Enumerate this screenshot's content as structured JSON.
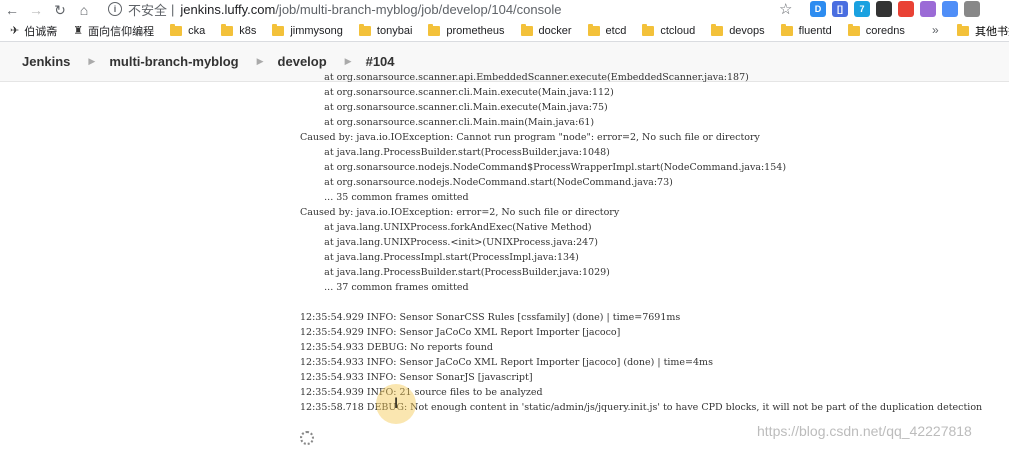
{
  "browser": {
    "insecure_label": "不安全",
    "url_domain": "jenkins.luffy.com",
    "url_path": "/job/multi-branch-myblog/job/develop/104/console",
    "extensions": [
      {
        "icon": "extension-d-icon",
        "text": "D",
        "color": "#2d8cf0"
      },
      {
        "icon": "extension-bracket-icon",
        "text": "[]",
        "color": "#4a6ee0"
      },
      {
        "icon": "extension-cloud-icon",
        "text": "7",
        "color": "#1aa1e0"
      },
      {
        "icon": "extension-qr-icon",
        "text": "",
        "color": "#333333"
      },
      {
        "icon": "extension-chrome-icon",
        "text": "",
        "color": "#e94235"
      },
      {
        "icon": "extension-palette-icon",
        "text": "",
        "color": "#9b6bd6"
      },
      {
        "icon": "extension-bird-icon",
        "text": "",
        "color": "#4f8ef7"
      },
      {
        "icon": "profile-avatar-icon",
        "text": "",
        "color": "#888888"
      }
    ]
  },
  "bookmarks": {
    "items": [
      {
        "label": "伯诚斋",
        "type": "logo"
      },
      {
        "label": "面向信仰编程",
        "type": "logo"
      },
      {
        "label": "cka",
        "type": "folder"
      },
      {
        "label": "k8s",
        "type": "folder"
      },
      {
        "label": "jimmysong",
        "type": "folder"
      },
      {
        "label": "tonybai",
        "type": "folder"
      },
      {
        "label": "prometheus",
        "type": "folder"
      },
      {
        "label": "docker",
        "type": "folder"
      },
      {
        "label": "etcd",
        "type": "folder"
      },
      {
        "label": "ctcloud",
        "type": "folder"
      },
      {
        "label": "devops",
        "type": "folder"
      },
      {
        "label": "fluentd",
        "type": "folder"
      },
      {
        "label": "coredns",
        "type": "folder"
      }
    ],
    "more": "»",
    "other_label": "其他书签"
  },
  "breadcrumb": {
    "items": [
      "Jenkins",
      "multi-branch-myblog",
      "develop",
      "#104"
    ]
  },
  "console": {
    "lines": [
      "        at org.sonarsource.scanner.api.EmbeddedScanner.execute(EmbeddedScanner.java:187)",
      "        at org.sonarsource.scanner.cli.Main.execute(Main.java:112)",
      "        at org.sonarsource.scanner.cli.Main.execute(Main.java:75)",
      "        at org.sonarsource.scanner.cli.Main.main(Main.java:61)",
      "Caused by: java.io.IOException: Cannot run program \"node\": error=2, No such file or directory",
      "        at java.lang.ProcessBuilder.start(ProcessBuilder.java:1048)",
      "        at org.sonarsource.nodejs.NodeCommand$ProcessWrapperImpl.start(NodeCommand.java:154)",
      "        at org.sonarsource.nodejs.NodeCommand.start(NodeCommand.java:73)",
      "        ... 35 common frames omitted",
      "Caused by: java.io.IOException: error=2, No such file or directory",
      "        at java.lang.UNIXProcess.forkAndExec(Native Method)",
      "        at java.lang.UNIXProcess.<init>(UNIXProcess.java:247)",
      "        at java.lang.ProcessImpl.start(ProcessImpl.java:134)",
      "        at java.lang.ProcessBuilder.start(ProcessBuilder.java:1029)",
      "        ... 37 common frames omitted",
      "",
      "12:35:54.929 INFO: Sensor SonarCSS Rules [cssfamily] (done) | time=7691ms",
      "12:35:54.929 INFO: Sensor JaCoCo XML Report Importer [jacoco]",
      "12:35:54.933 DEBUG: No reports found",
      "12:35:54.933 INFO: Sensor JaCoCo XML Report Importer [jacoco] (done) | time=4ms",
      "12:35:54.933 INFO: Sensor SonarJS [javascript]",
      "12:35:54.939 INFO: 21 source files to be analyzed"
    ],
    "last_line": "12:35:58.718 DEBUG: Not enough content in 'static/admin/js/jquery.init.js' to have CPD blocks, it will not be part of the duplication detection"
  },
  "watermark": "https://blog.csdn.net/qq_42227818"
}
